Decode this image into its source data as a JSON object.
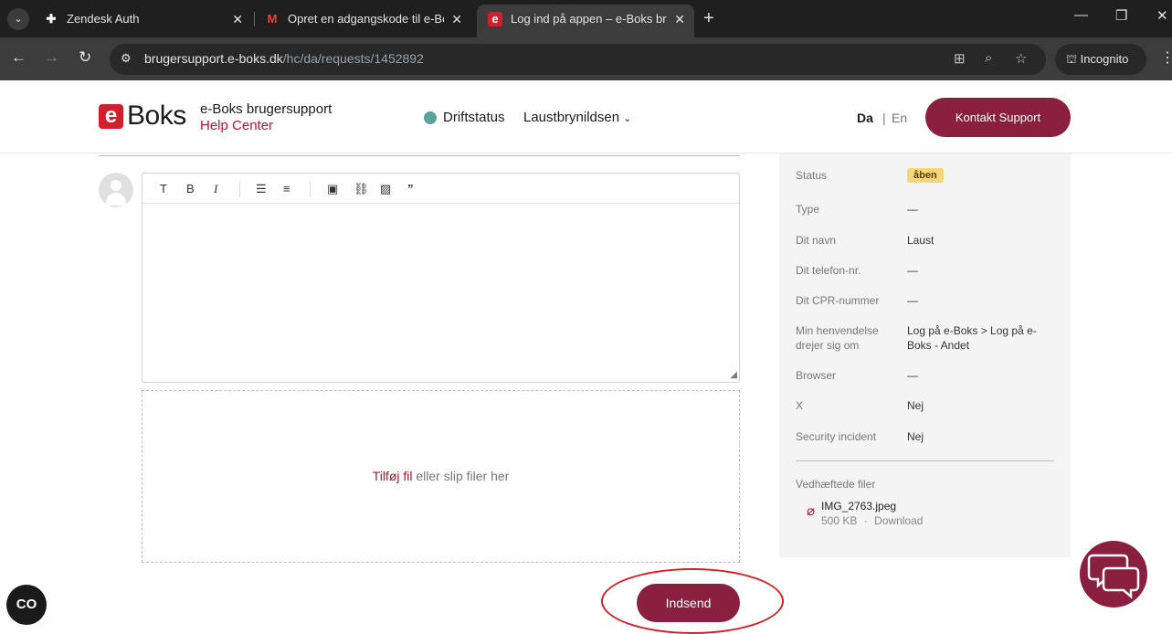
{
  "browser": {
    "tabs": [
      {
        "title": "Zendesk Auth",
        "icon": "zendesk-icon"
      },
      {
        "title": "Opret en adgangskode til e-Bok",
        "icon": "gmail-icon"
      },
      {
        "title": "Log ind på appen – e-Boks bruge",
        "icon": "eboks-icon"
      }
    ],
    "url_domain": "brugersupport.e-boks.dk",
    "url_path": "/hc/da/requests/1452892",
    "incognito_label": "Incognito"
  },
  "header": {
    "logo_e": "e",
    "logo_text": "Boks",
    "brand_title": "e-Boks brugersupport",
    "brand_subtitle": "Help Center",
    "status_label": "Driftstatus",
    "status_color": "#5aa39c",
    "user_name": "Laustbrynildsen",
    "lang_da": "Da",
    "lang_sep": "|",
    "lang_en": "En",
    "contact_label": "Kontakt Support"
  },
  "editor": {
    "tools": [
      "T",
      "B",
      "I"
    ],
    "dropzone_link": "Tilføj fil",
    "dropzone_text": " eller slip filer her",
    "submit_label": "Indsend"
  },
  "sidebar": {
    "fields": [
      {
        "label": "Status",
        "value": "åben",
        "badge": true
      },
      {
        "label": "Type",
        "value": "—"
      },
      {
        "label": "Dit navn",
        "value": "Laust"
      },
      {
        "label": "Dit telefon-nr.",
        "value": "—"
      },
      {
        "label": "Dit CPR-nummer",
        "value": "—"
      },
      {
        "label": "Min henvendelse drejer sig om",
        "value": "Log på e-Boks > Log på e-Boks - Andet"
      },
      {
        "label": "Browser",
        "value": "—"
      },
      {
        "label": "X",
        "value": "Nej"
      },
      {
        "label": "Security incident",
        "value": "Nej"
      }
    ],
    "attachments_label": "Vedhæftede filer",
    "attachment": {
      "name": "IMG_2763.jpeg",
      "size": "500 KB",
      "sep": "·",
      "download": "Download"
    }
  },
  "colors": {
    "brand": "#8a1f3f",
    "accent_red": "#c8102e",
    "badge": "#f7d57a"
  }
}
